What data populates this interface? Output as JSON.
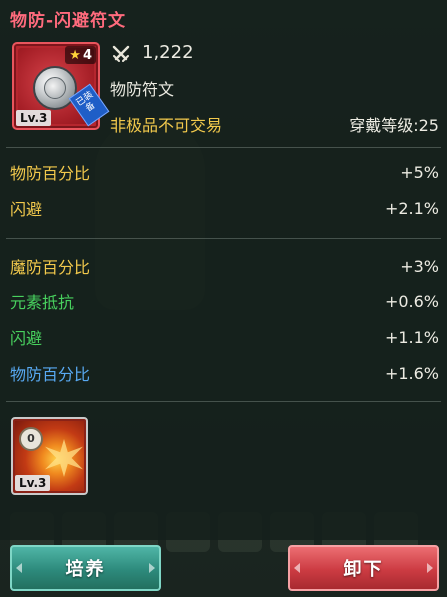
{
  "tooltip": {
    "title": "物防-闪避符文",
    "item": {
      "stars": "4",
      "level": "Lv.3",
      "equipped_badge": "已装备",
      "icon": "silver-rune-coin-icon"
    },
    "power": "1,222",
    "name": "物防符文",
    "trade_status": "非极品不可交易",
    "wear_level": "穿戴等级:25",
    "primary_stats": [
      {
        "label": "物防百分比",
        "value": "+5%"
      },
      {
        "label": "闪避",
        "value": "+2.1%"
      }
    ],
    "secondary_stats": [
      {
        "label": "魔防百分比",
        "value": "+3%",
        "color": "#f2c94c"
      },
      {
        "label": "元素抵抗",
        "value": "+0.6%",
        "color": "#48d15e"
      },
      {
        "label": "闪避",
        "value": "+1.1%",
        "color": "#48d15e"
      },
      {
        "label": "物防百分比",
        "value": "+1.6%",
        "color": "#58a9f2"
      }
    ],
    "skill": {
      "level": "Lv.3",
      "icon": "fire-skill-icon"
    }
  },
  "buttons": {
    "train_label": "培养",
    "remove_label": "卸下"
  },
  "colors": {
    "title": "#ff6b7d",
    "yellow": "#f2c94c",
    "green": "#48d15e",
    "blue": "#58a9f2",
    "train_button": "#2d8a7c",
    "remove_button": "#cc3b42"
  }
}
